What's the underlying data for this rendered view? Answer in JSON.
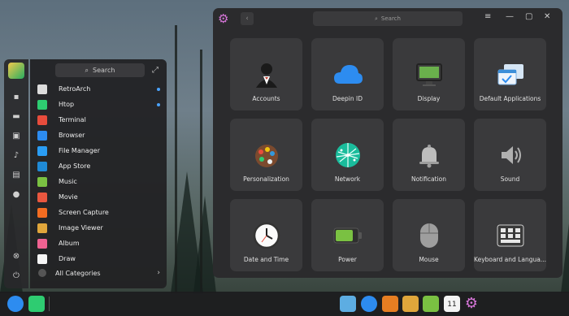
{
  "launcher": {
    "search_placeholder": "Search",
    "apps": [
      {
        "label": "RetroArch",
        "icon": "retroarch-icon",
        "color": "#dcdcdc",
        "new": true
      },
      {
        "label": "Htop",
        "icon": "htop-icon",
        "color": "#2ecc71",
        "new": true
      },
      {
        "label": "Terminal",
        "icon": "terminal-icon",
        "color": "#e74c3c",
        "new": false
      },
      {
        "label": "Browser",
        "icon": "browser-icon",
        "color": "#2d8cf0",
        "new": false
      },
      {
        "label": "File Manager",
        "icon": "file-manager-icon",
        "color": "#2a9df4",
        "new": false
      },
      {
        "label": "App Store",
        "icon": "app-store-icon",
        "color": "#1f8ad6",
        "new": false
      },
      {
        "label": "Music",
        "icon": "music-icon",
        "color": "#7ac142",
        "new": false
      },
      {
        "label": "Movie",
        "icon": "movie-icon",
        "color": "#e9573f",
        "new": false
      },
      {
        "label": "Screen Capture",
        "icon": "screen-capture-icon",
        "color": "#f36c21",
        "new": false
      },
      {
        "label": "Image Viewer",
        "icon": "image-viewer-icon",
        "color": "#e0a63b",
        "new": false
      },
      {
        "label": "Album",
        "icon": "album-icon",
        "color": "#f06292",
        "new": false
      },
      {
        "label": "Draw",
        "icon": "draw-icon",
        "color": "#f5f5f5",
        "new": false
      }
    ],
    "all_categories": "All Categories"
  },
  "control_center": {
    "search_placeholder": "Search",
    "tiles": [
      {
        "label": "Accounts",
        "icon": "accounts-icon"
      },
      {
        "label": "Deepin ID",
        "icon": "cloud-icon"
      },
      {
        "label": "Display",
        "icon": "display-icon"
      },
      {
        "label": "Default Applications",
        "icon": "default-applications-icon"
      },
      {
        "label": "Personalization",
        "icon": "personalization-icon"
      },
      {
        "label": "Network",
        "icon": "network-icon"
      },
      {
        "label": "Notification",
        "icon": "bell-icon"
      },
      {
        "label": "Sound",
        "icon": "speaker-icon"
      },
      {
        "label": "Date and Time",
        "icon": "clock-icon"
      },
      {
        "label": "Power",
        "icon": "battery-icon"
      },
      {
        "label": "Mouse",
        "icon": "mouse-icon"
      },
      {
        "label": "Keyboard and Langua...",
        "icon": "keyboard-icon"
      }
    ]
  },
  "dock": {
    "calendar_day": "11"
  }
}
